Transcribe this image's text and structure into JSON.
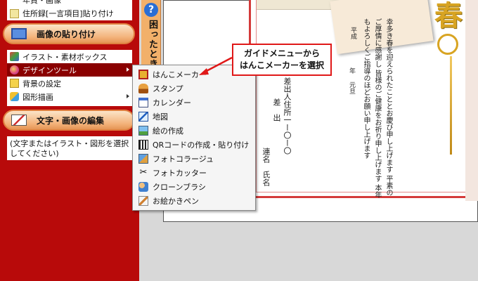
{
  "sidebar": {
    "top_rows": [
      "年賀・画像",
      "住所録[一言項目]貼り付け"
    ],
    "image_section_button": "画像の貼り付け",
    "image_items": [
      {
        "label": "イラスト・素材ボックス"
      },
      {
        "label": "デザインツール",
        "active": true,
        "submenu": true
      },
      {
        "label": "背景の設定"
      },
      {
        "label": "図形描画",
        "submenu": true
      }
    ],
    "edit_section_button": "文字・画像の編集",
    "edit_note": "(文字またはイラスト・図形を選択してください)"
  },
  "help_tab": {
    "icon": "question-icon",
    "label": "困ったとき"
  },
  "submenu": [
    {
      "icon": "seal-maker-icon",
      "label": "はんこメーカー"
    },
    {
      "icon": "stamp-icon",
      "label": "スタンプ"
    },
    {
      "icon": "calendar-icon",
      "label": "カレンダー"
    },
    {
      "icon": "map-icon",
      "label": "地図"
    },
    {
      "icon": "picture-icon",
      "label": "絵の作成"
    },
    {
      "icon": "qr-code-icon",
      "label": "QRコードの作成・貼り付け"
    },
    {
      "icon": "photo-collage-icon",
      "label": "フォトコラージュ"
    },
    {
      "icon": "scissors-icon",
      "label": "フォトカッター"
    },
    {
      "icon": "clone-brush-icon",
      "label": "クローンブラシ"
    },
    {
      "icon": "pen-icon",
      "label": "お絵かきペン"
    }
  ],
  "callout": {
    "line1": "ガイドメニューから",
    "line2": "はんこメーカーを選択"
  },
  "card": {
    "haru": "春",
    "greeting": "幸多き春を迎えられたこととお慶び申し上げます 平素のご厚情に感謝し 皆様のご健康をお祈り申し上げます 本年もよろしくご指導のほどお願い申し上げます",
    "date_heisei": "平成",
    "date_year": "年",
    "date_gantan": "元旦",
    "sender_1": "差出人住所一ー〇ー〇",
    "sender_2": "差　出",
    "sender_3": "連名　氏名"
  },
  "colors": {
    "sidebar": "#b80a0a",
    "active_item": "#8a0000",
    "callout_border": "#e01818",
    "pill": "#f3b27a"
  }
}
